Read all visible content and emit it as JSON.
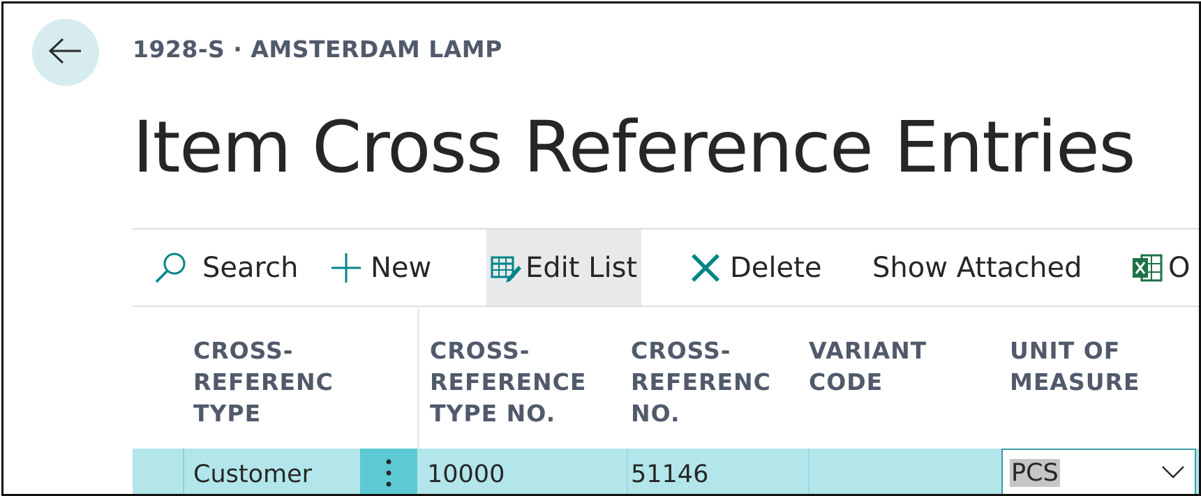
{
  "header": {
    "breadcrumb": "1928-S · AMSTERDAM LAMP",
    "title": "Item Cross Reference Entries"
  },
  "toolbar": {
    "search_label": "Search",
    "new_label": "New",
    "edit_list_label": "Edit List",
    "delete_label": "Delete",
    "show_attached_label": "Show Attached",
    "open_in_excel_label": "O"
  },
  "columns": {
    "cross_reference_type": "CROSS-\nREFERENCE\nTYPE",
    "cross_reference_type_no": "CROSS-\nREFERENCE\nTYPE NO.",
    "cross_reference_no": "CROSS-\nREFERENCE\nNO.",
    "variant_code": "VARIANT\nCODE",
    "unit_of_measure": "UNIT OF\nMEASURE"
  },
  "rows": [
    {
      "cross_reference_type": "Customer",
      "cross_reference_type_no": "10000",
      "cross_reference_no": "51146",
      "variant_code": "",
      "unit_of_measure": "PCS"
    }
  ],
  "colors": {
    "accent": "#008489",
    "selected_row": "#b2e6ea",
    "row_menu": "#5dcad3",
    "back_button": "#d6ecef",
    "excel_green": "#1e7145"
  }
}
